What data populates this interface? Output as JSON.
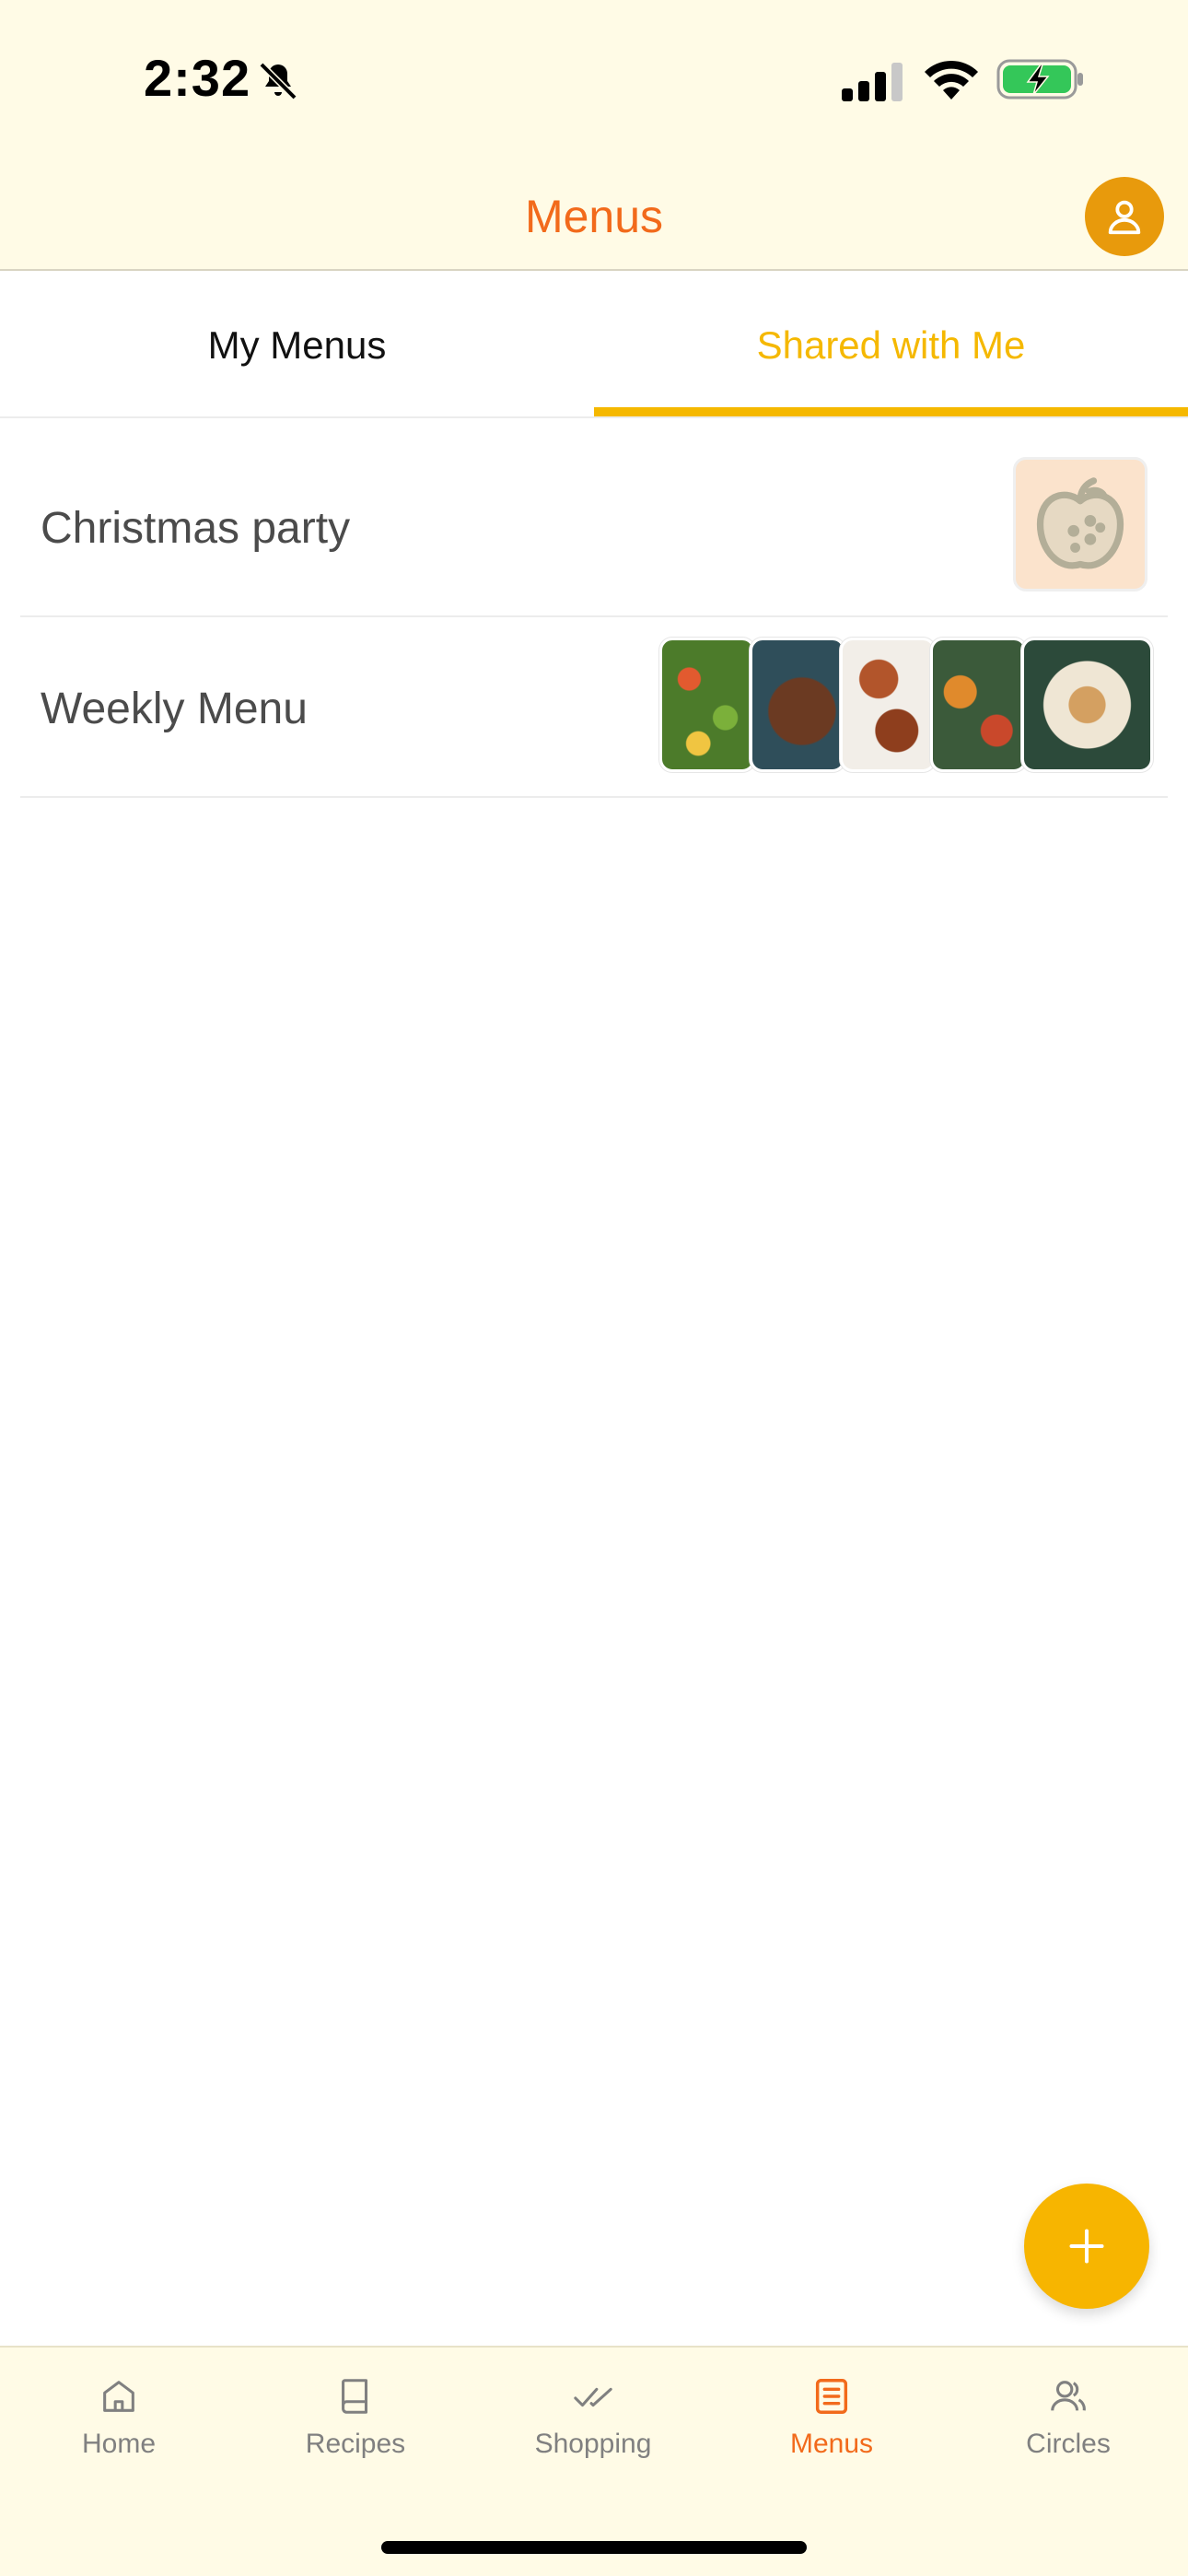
{
  "status_bar": {
    "time": "2:32"
  },
  "header": {
    "title": "Menus"
  },
  "tabs": [
    {
      "label": "My Menus",
      "active": false
    },
    {
      "label": "Shared with Me",
      "active": true
    }
  ],
  "menus": [
    {
      "name": "Christmas party"
    },
    {
      "name": "Weekly Menu"
    }
  ],
  "bottom_nav": [
    {
      "label": "Home",
      "icon": "home-icon",
      "active": false
    },
    {
      "label": "Recipes",
      "icon": "book-icon",
      "active": false
    },
    {
      "label": "Shopping",
      "icon": "double-check-icon",
      "active": false
    },
    {
      "label": "Menus",
      "icon": "list-icon",
      "active": true
    },
    {
      "label": "Circles",
      "icon": "people-icon",
      "active": false
    }
  ],
  "colors": {
    "accent_orange": "#f26a1b",
    "accent_yellow": "#f5b800",
    "header_bg": "#fffbe6",
    "avatar_bg": "#e89a0c"
  }
}
